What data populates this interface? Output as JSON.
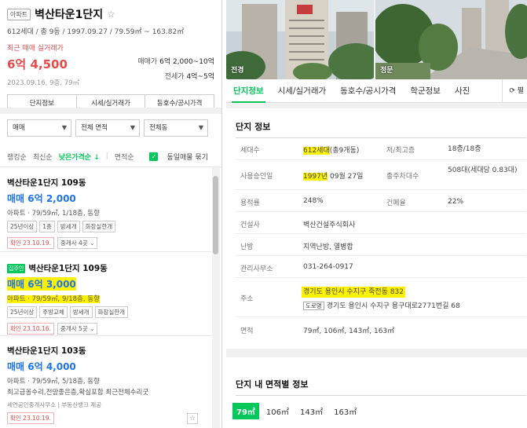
{
  "complex": {
    "badge": "아파트",
    "name": "벽산타운1단지",
    "star": "☆",
    "info": "612세대 / 총 9동 / 1997.09.27 / 79.59㎡ ~ 163.82㎡"
  },
  "recent": {
    "label": "최근 매매 실거래가",
    "price": "6억 4,500",
    "date": "2023.09.16, 9층, 79㎡",
    "sale_label": "매매가",
    "sale_value": "6억 2,000~10억",
    "jeonse_label": "전세가",
    "jeonse_value": "4억~5억"
  },
  "main_tabs": [
    "단지정보",
    "시세/실거래가",
    "동호수/공시가격"
  ],
  "filters": [
    {
      "label": "매매"
    },
    {
      "label": "전체 면적"
    },
    {
      "label": "전체동"
    }
  ],
  "sorts": {
    "items": [
      "랭킹순",
      "최신순",
      "낮은가격순 ↓",
      "면적순"
    ],
    "checkbox_label": "동일매물 묶기"
  },
  "listings": [
    {
      "name": "벽산타운1단지 109동",
      "price": "매매 6억 2,000",
      "desc": "아파트 · 79/59㎡, 1/18층, 동향",
      "chips": [
        "25년이상",
        "1층",
        "방세개",
        "화장실한개"
      ],
      "confirm": "확인 23.10.19.",
      "agent": "중개사 4곳 ⌄"
    },
    {
      "tag": "집주인",
      "name": "벽산타운1단지 109동",
      "price": "매매 6억 3,000",
      "desc_hl": "아파트 · 79/59㎡, 9/18층, 동향",
      "chips": [
        "25년이상",
        "주방교체",
        "방세개",
        "화장실한개"
      ],
      "confirm": "확인 23.10.16.",
      "agent": "중개사 5곳 ⌄"
    },
    {
      "name": "벽산타운1단지 103동",
      "price": "매매 6억 4,000",
      "desc": "아파트 · 79/59㎡, 5/18층, 동향",
      "desc2": "최고급올수리,전망좋은층,확실포함 최근전체수리굿",
      "agents": "세연공인중개사무소 | 부동산뱅크 제공",
      "confirm": "확인 23.10.19."
    }
  ],
  "photos": [
    {
      "label": "전경"
    },
    {
      "label": "정문"
    }
  ],
  "right_tabs": [
    "단지정보",
    "시세/실거래가",
    "동호수/공시가격",
    "학군정보",
    "사진"
  ],
  "refresh": "⟳ 펼",
  "complex_info": {
    "title": "단지 정보",
    "rows": [
      {
        "k": "세대수",
        "v_hl": "612세대",
        "v_rest": "(총9개동)",
        "k2": "저/최고층",
        "v2": "18층/18층"
      },
      {
        "k": "사용승인일",
        "v_hl": "1997년",
        "v_rest": " 09월 27일",
        "k2": "총주차대수",
        "v2": "508대(세대당 0.83대)"
      },
      {
        "k": "용적률",
        "v": "248%",
        "k2": "건폐율",
        "v2": "22%"
      },
      {
        "k": "건설사",
        "v": "벽산건설주식회사"
      },
      {
        "k": "난방",
        "v": "지역난방, 열병합"
      },
      {
        "k": "관리사무소",
        "v": "031-264-0917"
      },
      {
        "k": "주소",
        "v_hl": "경기도 용인시 수지구 죽전동 832",
        "road": "도로명",
        "v_road": "경기도 용인시 수지구 용구대로2771번길 68"
      },
      {
        "k": "면적",
        "v": "79㎡, 106㎡, 143㎡, 163㎡"
      }
    ]
  },
  "area_info": {
    "title": "단지 내 면적별 정보",
    "areas": [
      "79㎡",
      "106㎡",
      "143㎡",
      "163㎡"
    ]
  },
  "colors": {
    "accent": "#03c75a",
    "price_blue": "#1e73e8",
    "red": "#e94b4b",
    "highlight": "#fff200"
  }
}
